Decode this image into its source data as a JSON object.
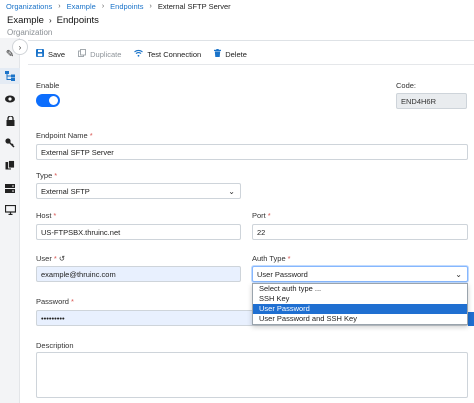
{
  "breadcrumb": {
    "items": [
      "Organizations",
      "Example",
      "Endpoints",
      "External SFTP Server"
    ]
  },
  "header": {
    "title_parent": "Example",
    "title_current": "Endpoints",
    "subtitle": "Organization"
  },
  "sidebar": {
    "expander_icon": "chevron-right-icon",
    "icons": [
      "edit-icon",
      "hierarchy-icon",
      "eye-icon",
      "lock-icon",
      "key-icon",
      "files-icon",
      "server-icon",
      "monitor-icon"
    ]
  },
  "toolbar": {
    "save_label": "Save",
    "duplicate_label": "Duplicate",
    "test_label": "Test Connection",
    "delete_label": "Delete"
  },
  "form": {
    "enable_label": "Enable",
    "enable_value": true,
    "code_label": "Code:",
    "code_value": "END4H6R",
    "endpoint_name_label": "Endpoint Name",
    "endpoint_name_value": "External SFTP Server",
    "type_label": "Type",
    "type_value": "External SFTP",
    "host_label": "Host",
    "host_value": "US-FTPSBX.thruinc.net",
    "port_label": "Port",
    "port_value": "22",
    "user_label": "User",
    "user_value": "example@thruinc.com",
    "auth_type_label": "Auth Type",
    "auth_type_value": "User Password",
    "password_label": "Password",
    "password_value": "•••••••••",
    "description_label": "Description",
    "description_value": "",
    "required_marker": "*",
    "user_reset_icon": "↺"
  },
  "auth_dropdown": {
    "options": [
      "Select auth type ...",
      "SSH Key",
      "User Password",
      "User Password and SSH Key"
    ],
    "selected_index": 2
  },
  "colors": {
    "accent": "#1a73c9",
    "toggle_on": "#0d6efd",
    "required": "#d9534f",
    "selected_option": "#1f6fd1"
  }
}
